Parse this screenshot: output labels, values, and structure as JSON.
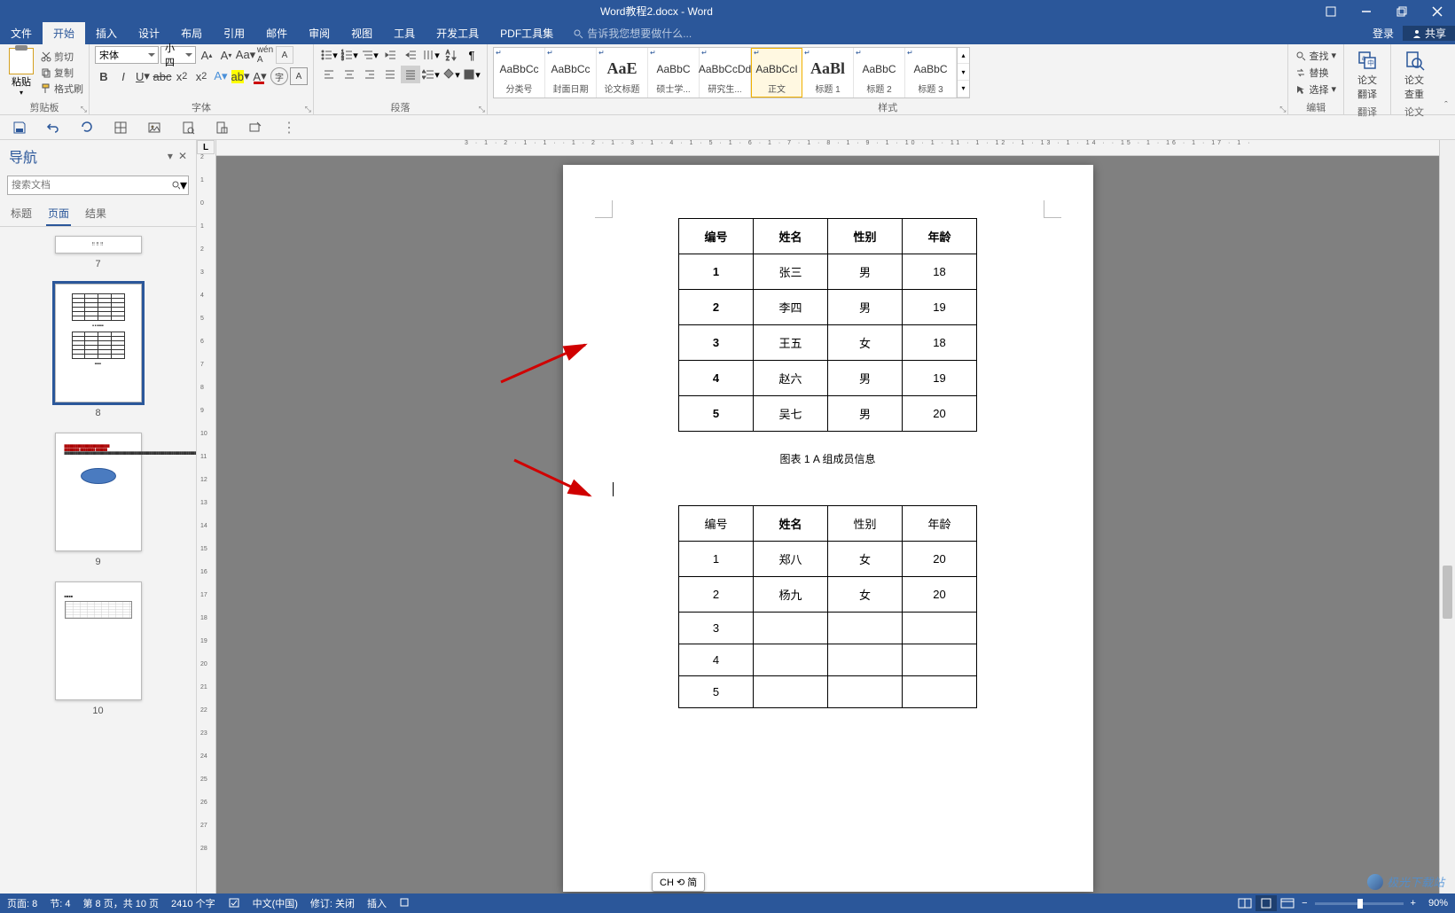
{
  "titlebar": {
    "title": "Word教程2.docx - Word"
  },
  "menutabs": {
    "file": "文件",
    "tabs": [
      "开始",
      "插入",
      "设计",
      "布局",
      "引用",
      "邮件",
      "审阅",
      "视图",
      "工具",
      "开发工具",
      "PDF工具集"
    ],
    "active_index": 0,
    "tellme_placeholder": "告诉我您想要做什么...",
    "login": "登录",
    "share": "共享"
  },
  "ribbon": {
    "clipboard": {
      "paste": "粘贴",
      "cut": "剪切",
      "copy": "复制",
      "format_painter": "格式刷",
      "label": "剪贴板"
    },
    "font": {
      "name": "宋体",
      "size": "小四",
      "label": "字体"
    },
    "paragraph": {
      "label": "段落"
    },
    "styles": {
      "label": "样式",
      "items": [
        {
          "preview": "AaBbCc",
          "name": "分类号"
        },
        {
          "preview": "AaBbCc",
          "name": "封面日期"
        },
        {
          "preview": "AaE",
          "name": "论文标题",
          "big": true,
          "serif": true
        },
        {
          "preview": "AaBbC",
          "name": "硕士学..."
        },
        {
          "preview": "AaBbCcDd",
          "name": "研究生..."
        },
        {
          "preview": "AaBbCcI",
          "name": "正文",
          "selected": true
        },
        {
          "preview": "AaBl",
          "name": "标题 1",
          "big": true,
          "serif": true
        },
        {
          "preview": "AaBbC",
          "name": "标题 2"
        },
        {
          "preview": "AaBbC",
          "name": "标题 3"
        }
      ]
    },
    "editing": {
      "find": "查找",
      "replace": "替换",
      "select": "选择",
      "label": "编辑"
    },
    "translate": {
      "line1": "论文",
      "line2": "翻译",
      "label": "翻译"
    },
    "review": {
      "line1": "论文",
      "line2": "查重",
      "label": "论文"
    }
  },
  "nav": {
    "title": "导航",
    "search_placeholder": "搜索文档",
    "tabs": [
      "标题",
      "页面",
      "结果"
    ],
    "active_tab": 1,
    "thumbs": [
      7,
      8,
      9,
      10
    ],
    "selected": 8
  },
  "document": {
    "table1": {
      "headers": [
        "编号",
        "姓名",
        "性别",
        "年龄"
      ],
      "rows": [
        [
          "1",
          "张三",
          "男",
          "18"
        ],
        [
          "2",
          "李四",
          "男",
          "19"
        ],
        [
          "3",
          "王五",
          "女",
          "18"
        ],
        [
          "4",
          "赵六",
          "男",
          "19"
        ],
        [
          "5",
          "吴七",
          "男",
          "20"
        ]
      ]
    },
    "caption1": "图表 1   A 组成员信息",
    "table2": {
      "headers": [
        "编号",
        "姓名",
        "性别",
        "年龄"
      ],
      "bold_header_index": 1,
      "rows": [
        [
          "1",
          "郑八",
          "女",
          "20"
        ],
        [
          "2",
          "杨九",
          "女",
          "20"
        ],
        [
          "3",
          "",
          "",
          ""
        ],
        [
          "4",
          "",
          "",
          ""
        ],
        [
          "5",
          "",
          "",
          ""
        ]
      ]
    }
  },
  "hruler_text": "3 · 1 · 2 · 1 · 1 ·   · 1 · 2 · 1 · 3 · 1 · 4 · 1 · 5 · 1 · 6 · 1 · 7 · 1 · 8 · 1 · 9 · 1 · 10 · 1 · 11 · 1 · 12 · 1 · 13 · 1 · 14 ·   · 15 · 1 · 16 · 1 · 17 · 1 ·",
  "statusbar": {
    "page": "页面: 8",
    "section": "节: 4",
    "pages": "第 8 页，共 10 页",
    "words": "2410 个字",
    "lang": "中文(中国)",
    "track": "修订: 关闭",
    "insert": "插入",
    "zoom": "90%"
  },
  "ime": "CH ⟲ 简",
  "watermark": "极光下载站",
  "tabsel": "L"
}
